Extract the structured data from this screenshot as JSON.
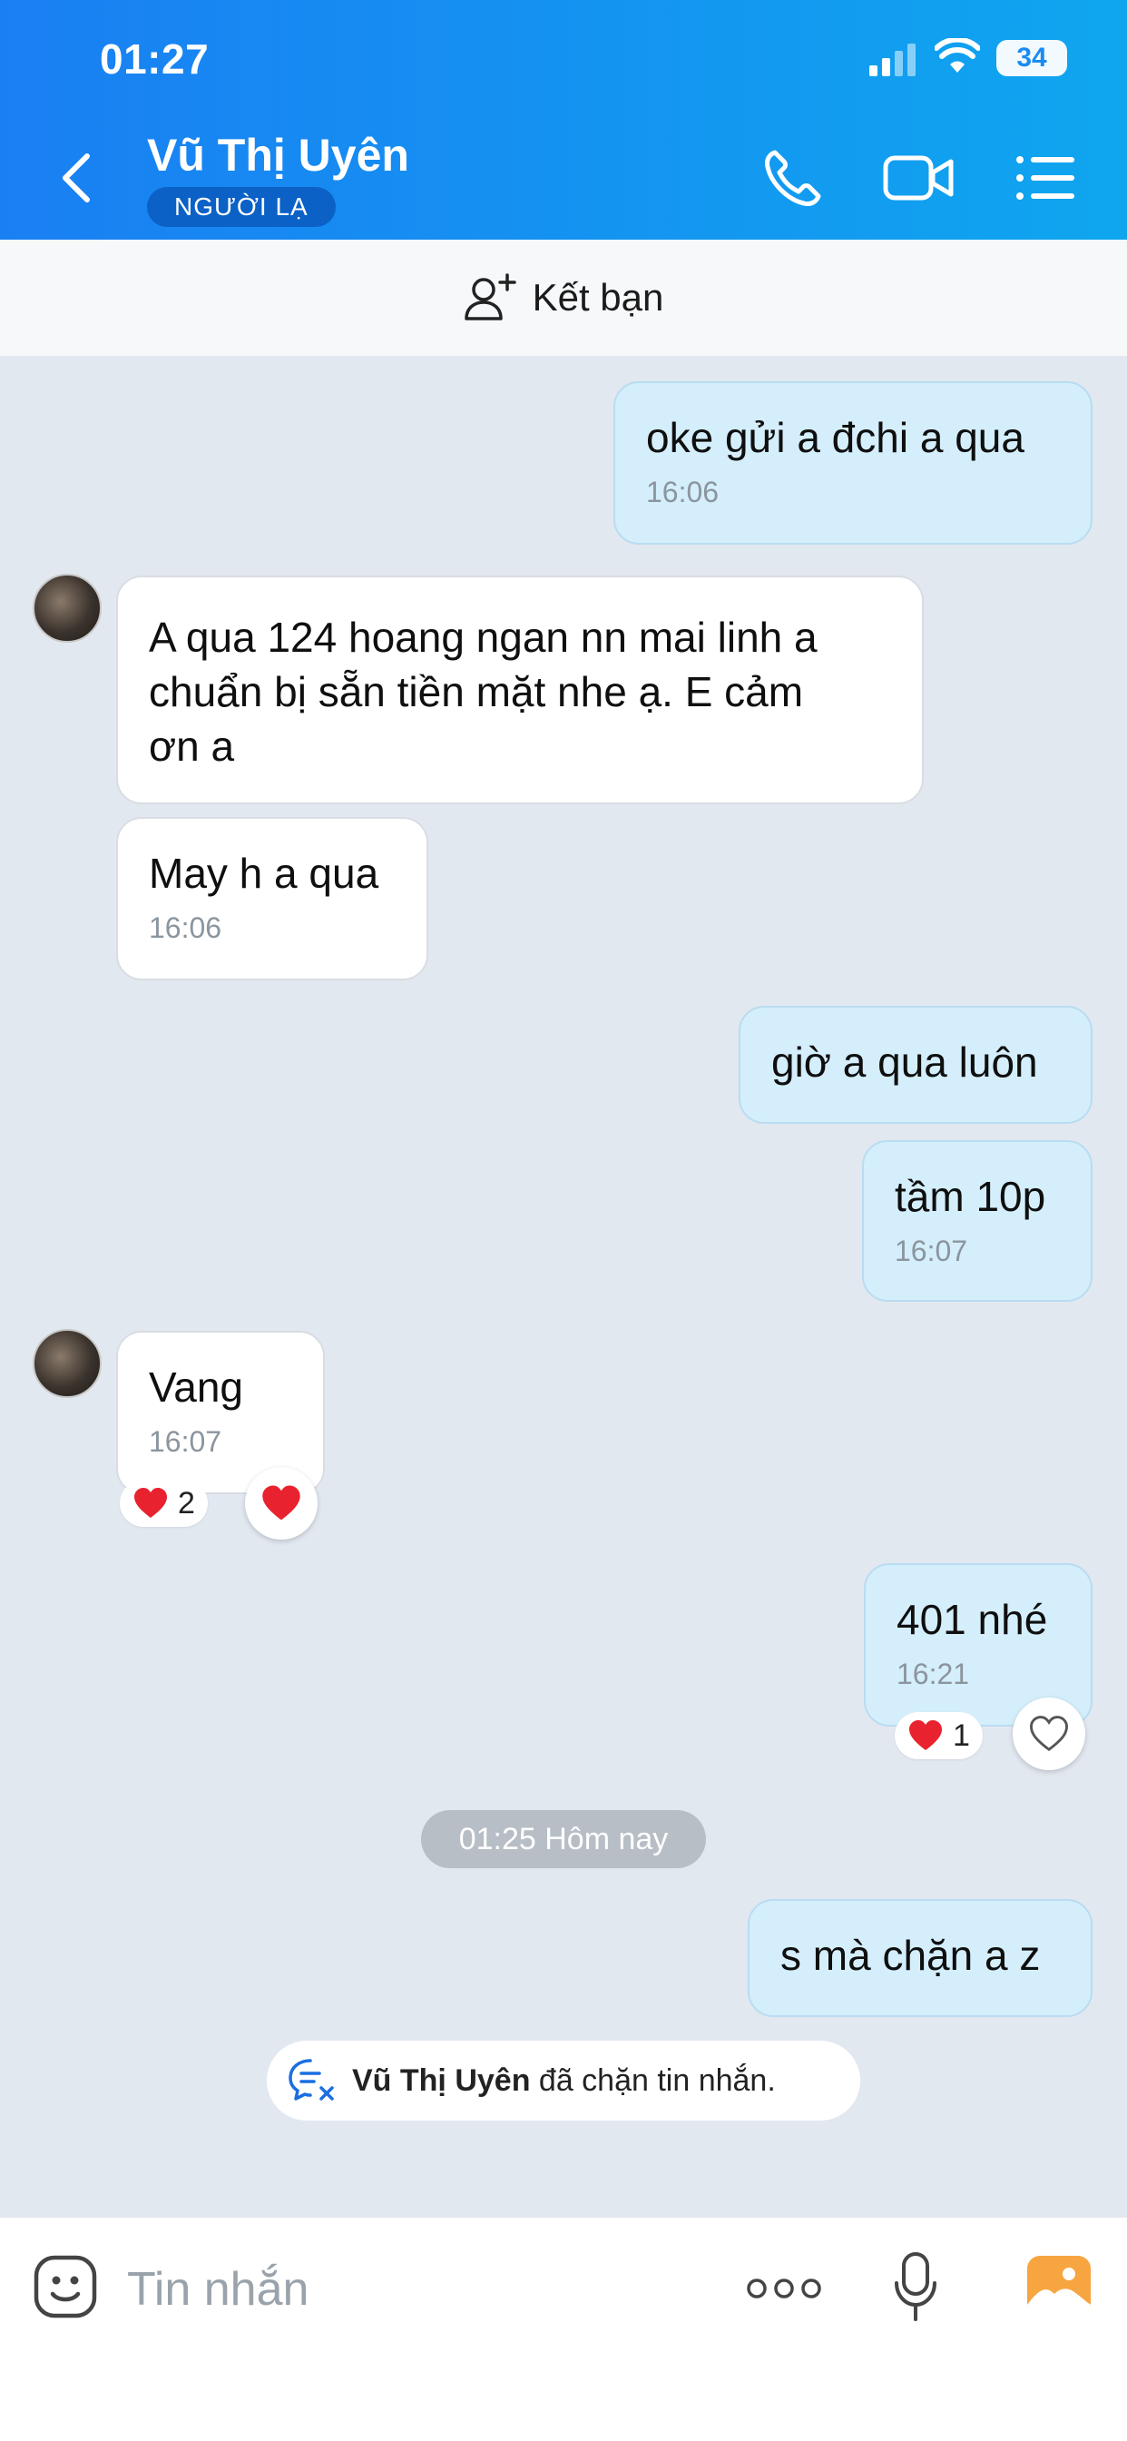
{
  "status_bar": {
    "time": "01:27",
    "battery": "34"
  },
  "header": {
    "contact_name": "Vũ Thị Uyên",
    "badge": "NGƯỜI LẠ"
  },
  "add_friend": {
    "label": "Kết bạn"
  },
  "messages": [
    {
      "direction": "outgoing",
      "text": "oke gửi a đchi a qua",
      "time": "16:06"
    },
    {
      "direction": "incoming",
      "text_lines": [
        "A qua 124 hoang ngan nn mai linh a",
        "chuẩn bị sẵn tiền mặt nhe ạ. E cảm",
        "ơn a"
      ]
    },
    {
      "direction": "incoming",
      "text": "May h a qua",
      "time": "16:06"
    },
    {
      "direction": "outgoing",
      "text": "giờ a qua luôn"
    },
    {
      "direction": "outgoing",
      "text": "tầm 10p",
      "time": "16:07"
    },
    {
      "direction": "incoming",
      "text": "Vang",
      "time": "16:07",
      "reaction_count": "2"
    },
    {
      "direction": "outgoing",
      "text": "401 nhé",
      "time": "16:21",
      "reaction_count": "1"
    },
    {
      "direction": "outgoing",
      "text": "s mà chặn a z"
    }
  ],
  "date_separator": "01:25 Hôm nay",
  "blocked_notice": {
    "name": "Vũ Thị Uyên",
    "text": " đã chặn tin nhắn."
  },
  "composer": {
    "placeholder": "Tin nhắn"
  },
  "colors": {
    "header_start": "#1a7ff3",
    "header_end": "#0fa6ef",
    "outgoing_bubble": "#d4eefb",
    "chat_bg": "#e2e8f0"
  },
  "icons": [
    "back-arrow-icon",
    "phone-icon",
    "video-call-icon",
    "list-menu-icon",
    "add-friend-icon",
    "heart-icon",
    "heart-outline-icon",
    "blocked-message-icon",
    "emoji-icon",
    "more-dots-icon",
    "microphone-icon",
    "image-icon"
  ]
}
